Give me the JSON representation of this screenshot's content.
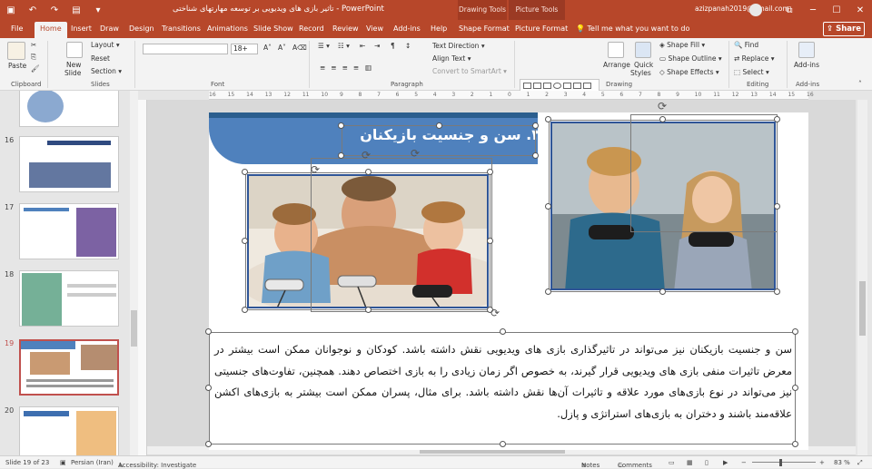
{
  "window": {
    "title": "تاثیر بازی های ویدیویی بر توسعه مهارتهای شناختی  -  PowerPoint",
    "context_tabs": [
      "Drawing Tools",
      "Picture Tools"
    ],
    "user_email": "azizpanah2019@gmail.com"
  },
  "tabs": [
    "File",
    "Home",
    "Insert",
    "Draw",
    "Design",
    "Transitions",
    "Animations",
    "Slide Show",
    "Record",
    "Review",
    "View",
    "Add-ins",
    "Help",
    "Shape Format",
    "Picture Format"
  ],
  "active_tab": "Home",
  "tell_me": "Tell me what you want to do",
  "share_label": "Share",
  "ribbon": {
    "clipboard": {
      "paste": "Paste",
      "label": "Clipboard"
    },
    "slides": {
      "new_slide": "New",
      "new_slide_2": "Slide",
      "layout": "Layout",
      "reset": "Reset",
      "section": "Section",
      "label": "Slides"
    },
    "font": {
      "font_size": "18+",
      "bold": "B",
      "italic": "I",
      "underline": "U",
      "strike": "S",
      "shadow": "ab",
      "spacing": "AV",
      "case": "Aa",
      "label": "Font"
    },
    "paragraph": {
      "text_direction": "Text Direction",
      "align_text": "Align Text",
      "smartart": "Convert to SmartArt",
      "label": "Paragraph"
    },
    "drawing": {
      "arrange": "Arrange",
      "quick_styles": "Quick",
      "quick_styles_2": "Styles",
      "shape_fill": "Shape Fill",
      "shape_outline": "Shape Outline",
      "shape_effects": "Shape Effects",
      "label": "Drawing"
    },
    "editing": {
      "find": "Find",
      "replace": "Replace",
      "select": "Select",
      "label": "Editing"
    },
    "addins": {
      "addins": "Add-ins",
      "label": "Add-ins"
    }
  },
  "ruler_ticks": [
    "16",
    "15",
    "14",
    "13",
    "12",
    "11",
    "10",
    "9",
    "8",
    "7",
    "6",
    "5",
    "4",
    "3",
    "2",
    "1",
    "0",
    "1",
    "2",
    "3",
    "4",
    "5",
    "6",
    "7",
    "8",
    "9",
    "10",
    "11",
    "12",
    "13",
    "14",
    "15",
    "16"
  ],
  "thumbnails": [
    {
      "number": "",
      "theme": "#3e6fb0"
    },
    {
      "number": "16",
      "theme": "#2f4a80"
    },
    {
      "number": "17",
      "theme": "#5b3b8c"
    },
    {
      "number": "18",
      "theme": "#3a8f6b"
    },
    {
      "number": "19",
      "theme": "#4f81bd",
      "selected": true
    },
    {
      "number": "20",
      "theme": "#3e6fb0"
    }
  ],
  "slide": {
    "title": "۳. سن و جنسیت بازیکنان",
    "body": "سن و جنسیت بازیکنان نیز می‌تواند در تاثیرگذاری بازی های ویدیویی نقش داشته باشد. کودکان و نوجوانان ممکن است بیشتر در معرض تاثیرات منفی بازی های ویدیویی قرار گیرند، به خصوص اگر زمان زیادی را به بازی اختصاص دهند. همچنین، تفاوت‌های جنسیتی نیز می‌تواند در نوع بازی‌های مورد علاقه و تاثیرات آن‌ها نقش داشته باشد. برای مثال، پسران ممکن است بیشتر به بازی‌های اکشن علاقه‌مند باشند و دختران به بازی‌های استراتژی و پازل.",
    "accent": "#4f81bd"
  },
  "status": {
    "slide_of": "Slide 19 of 23",
    "language": "Persian (Iran)",
    "accessibility": "Accessibility: Investigate",
    "notes": "Notes",
    "comments": "Comments",
    "zoom": "83 %"
  }
}
